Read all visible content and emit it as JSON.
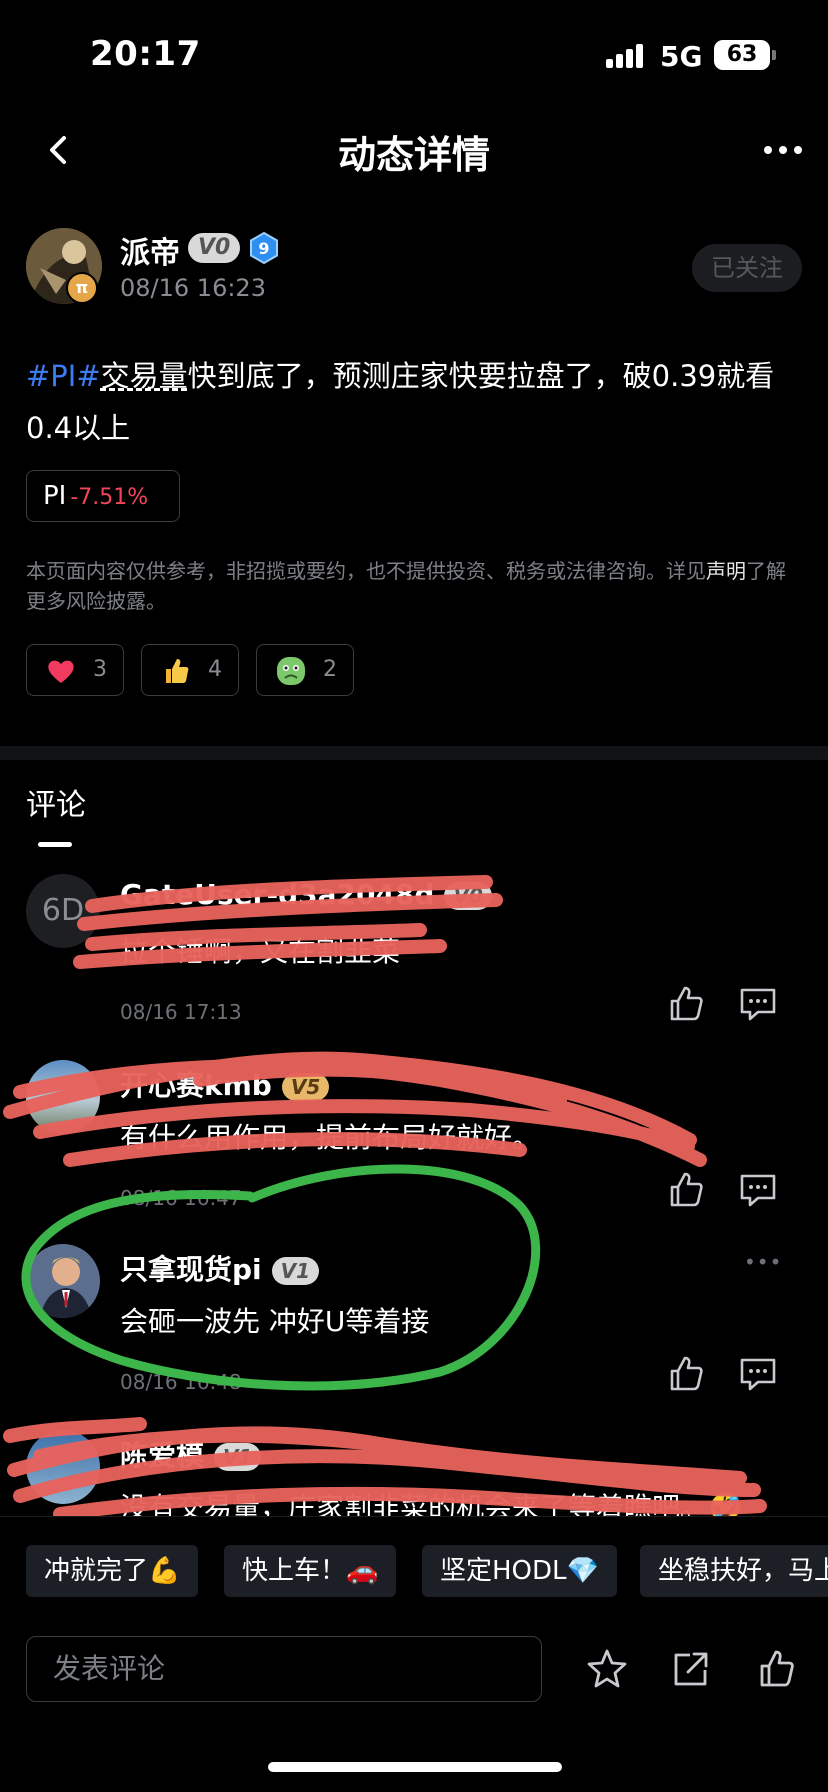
{
  "status_bar": {
    "time": "20:17",
    "network": "5G",
    "battery": "63"
  },
  "nav": {
    "title": "动态详情",
    "back_icon": "chevron-left-icon",
    "more_icon": "more-dots-icon"
  },
  "post": {
    "author": "派帝",
    "vip_badge": "V0",
    "level_badge": "9",
    "avatar_badge": "π",
    "time": "08/16 16:23",
    "follow_label": "已关注",
    "hashtag": "#PI#",
    "text_underlined": "交易量",
    "text_body": "快到底了，预测庄家快要拉盘了，破0.39就看0.4以上",
    "coin": {
      "symbol": "PI",
      "change": "-7.51%"
    },
    "disclaimer_prefix": "本页面内容仅供参考，非招揽或要约，也不提供投资、税务或法律咨询。详见",
    "disclaimer_link": "声明",
    "disclaimer_suffix": "了解更多风险披露。",
    "reactions": [
      {
        "icon": "heart-icon",
        "glyph": "❤",
        "count": "3"
      },
      {
        "icon": "thumbs-up-icon",
        "glyph": "👍",
        "count": "4"
      },
      {
        "icon": "sick-face-icon",
        "glyph": "🤢",
        "count": "2"
      }
    ]
  },
  "comments_header": "评论",
  "comments": [
    {
      "avatar_text": "6D",
      "name": "GateUser-d3a2048d",
      "badge": "V0",
      "text": "拉个锤啊，又在割韭菜",
      "time": "08/16 17:13"
    },
    {
      "name": "开心赛kmb",
      "badge": "V5",
      "text": "有什么用作用，提前布局好就好。",
      "time": "08/16 16:47"
    },
    {
      "name": "只拿现货pi",
      "badge": "V1",
      "text": "会砸一波先 冲好U等着接",
      "time": "08/16 16:48",
      "more": "•••"
    },
    {
      "name": "陈爱模",
      "badge": "V1",
      "text": "没有交易量，庄家割韭菜的机会来了等着瞧吧。🤣"
    }
  ],
  "quick_replies": [
    "冲就完了💪",
    "快上车！🚗",
    "坚定HODL💎",
    "坐稳扶好，马上起飞"
  ],
  "input_placeholder": "发表评论",
  "bottom_icons": [
    "star-icon",
    "share-icon",
    "thumbs-up-icon"
  ],
  "colors": {
    "background": "#000000",
    "hashtag": "#3d7cf0",
    "negative": "#f0455a",
    "scribble_red": "#e8625c",
    "scribble_green": "#3cb54a"
  }
}
